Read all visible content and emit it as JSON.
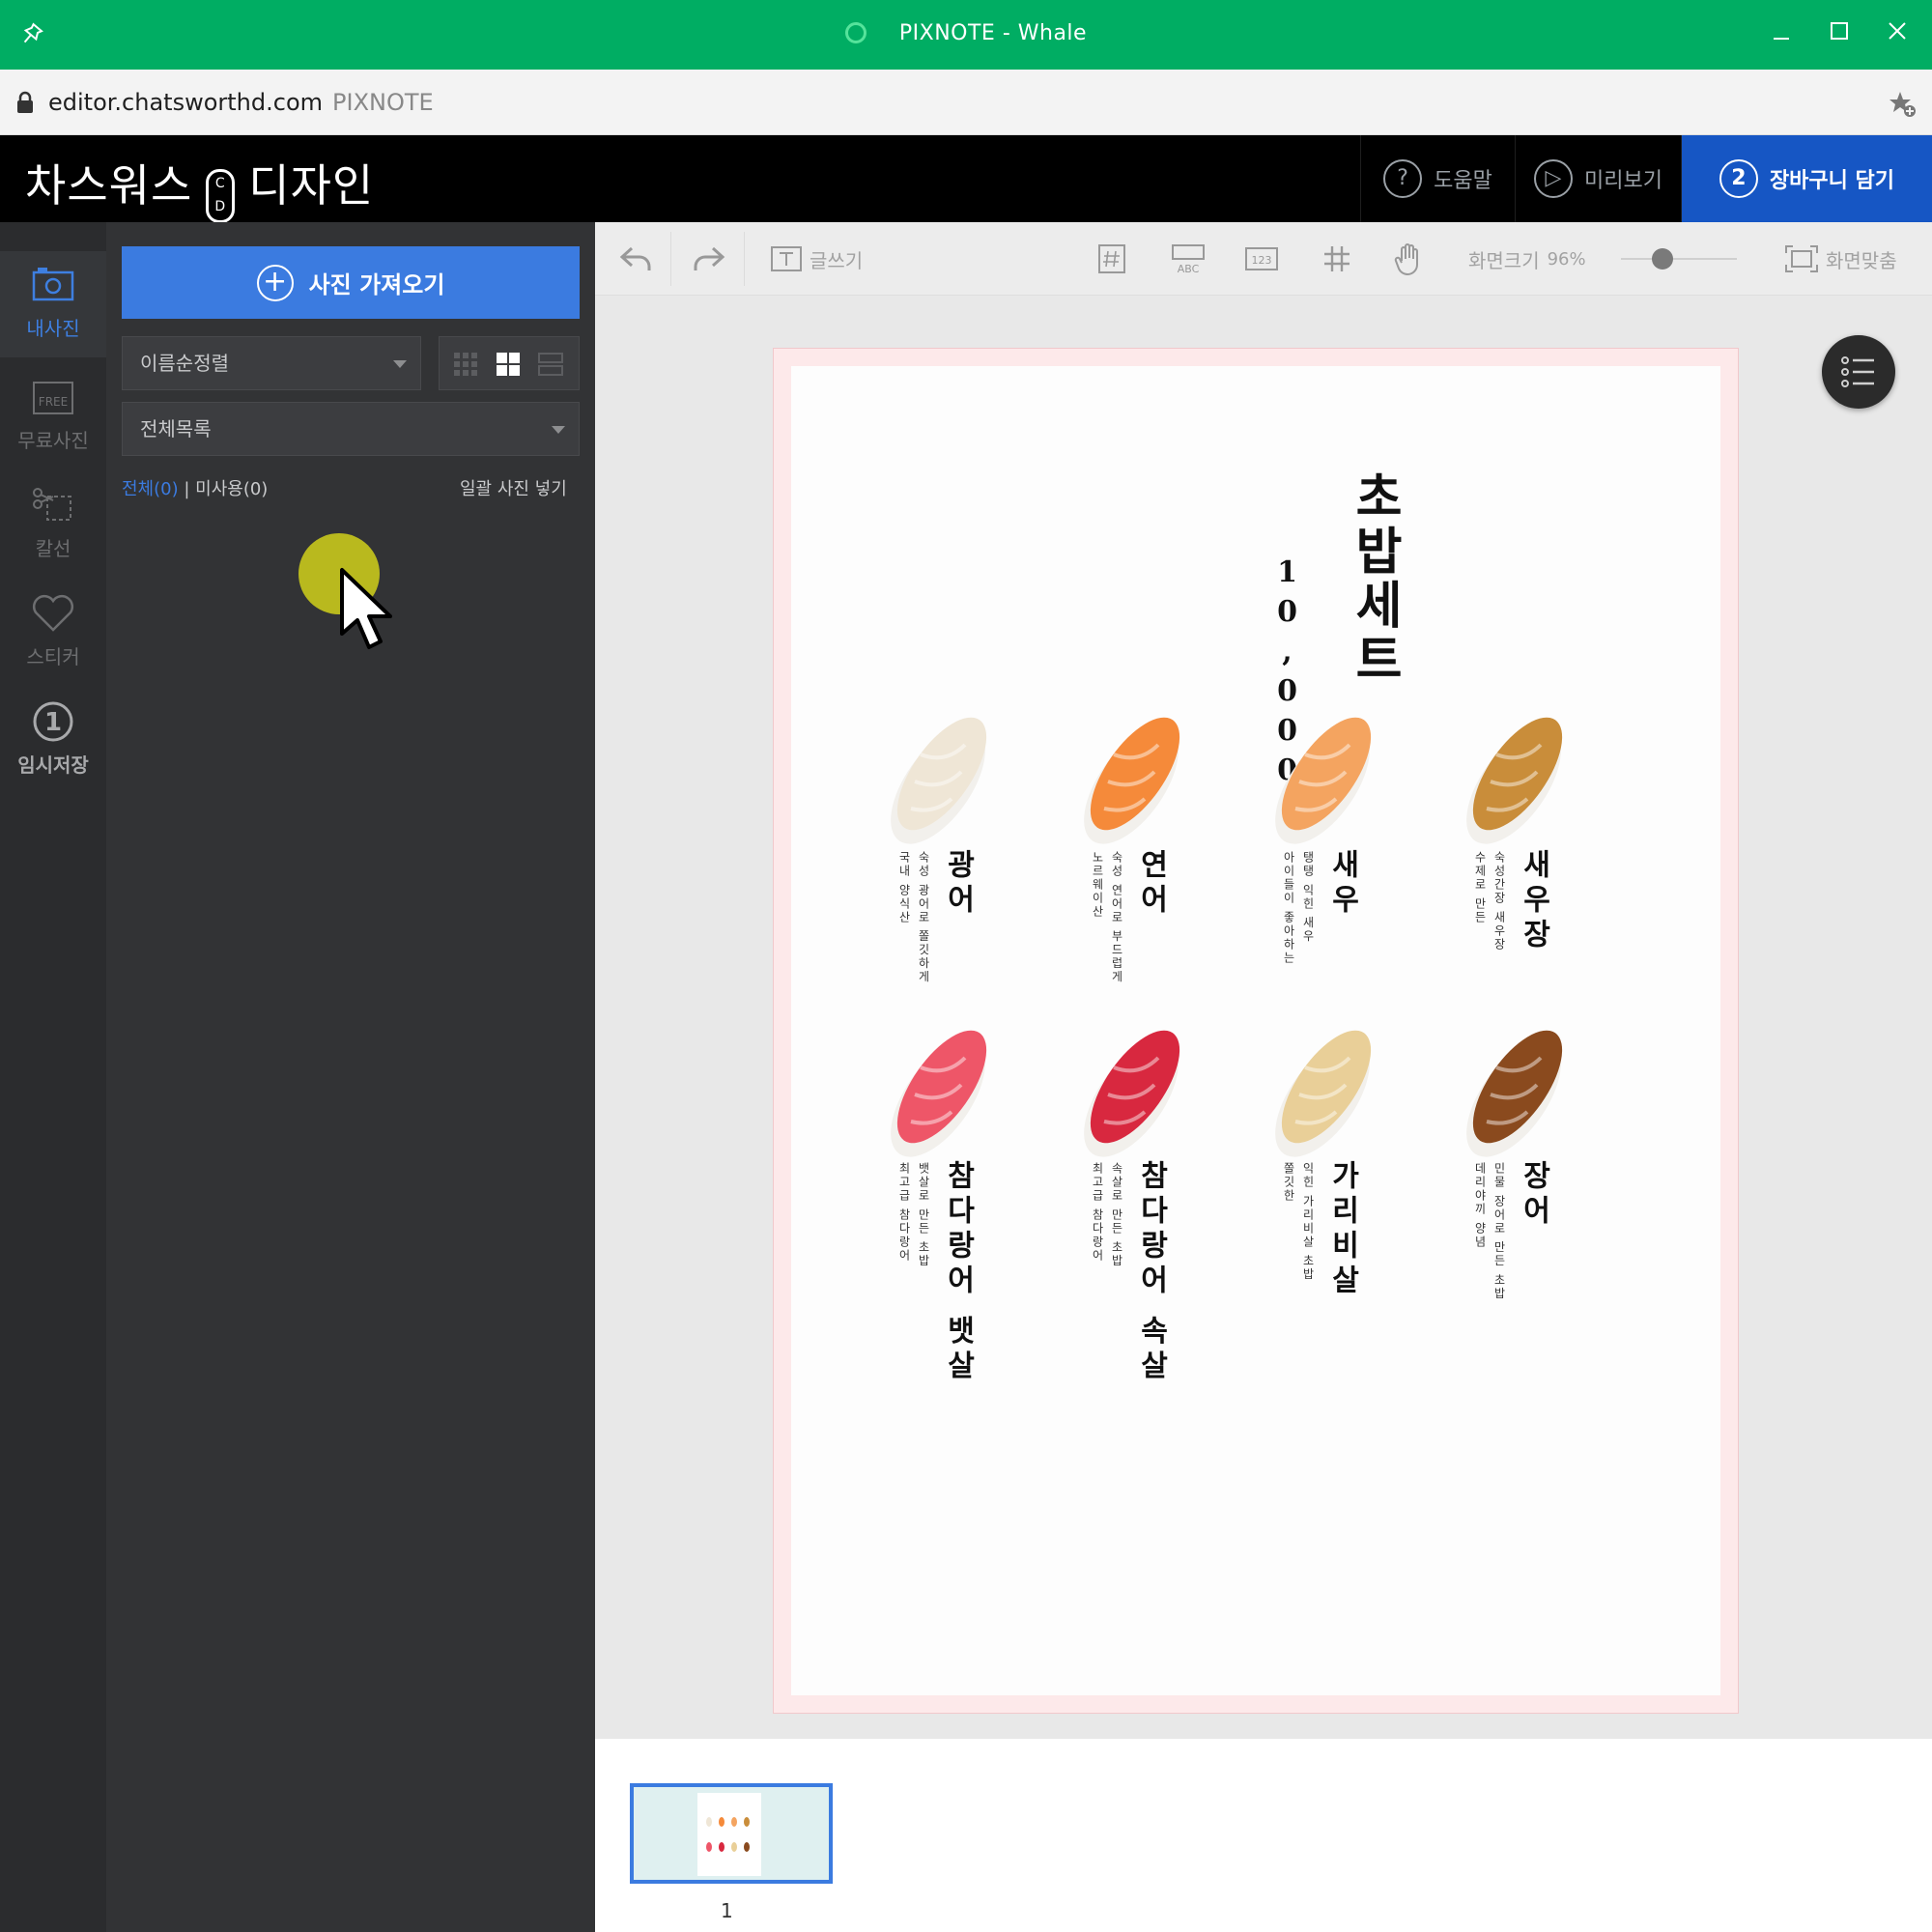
{
  "window": {
    "title": "PIXNOTE - Whale"
  },
  "address": {
    "url": "editor.chatsworthd.com",
    "site_name": "PIXNOTE"
  },
  "header": {
    "brand_left": "차스워스",
    "brand_logo": "C D",
    "brand_right": "디자인",
    "help_label": "도움말",
    "preview_label": "미리보기",
    "cart_step": "2",
    "cart_label": "장바구니 담기"
  },
  "rail": {
    "items": [
      {
        "label": "내사진",
        "icon": "camera-icon",
        "active": true
      },
      {
        "label": "무료사진",
        "icon": "free-photo-icon"
      },
      {
        "label": "칼선",
        "icon": "scissors-icon"
      },
      {
        "label": "스티커",
        "icon": "heart-icon"
      },
      {
        "label": "임시저장",
        "icon": "step-one-icon",
        "step": "1"
      }
    ]
  },
  "panel": {
    "import_label": "사진 가져오기",
    "sort_value": "이름순정렬",
    "folder_value": "전체목록",
    "count_all": "전체(0)",
    "count_unused": "미사용(0)",
    "bulk_insert": "일괄 사진 넣기"
  },
  "toolbar": {
    "text_tool": "글쓰기",
    "zoom_label": "화면크기",
    "zoom_value": "96%",
    "zoom_level": 0.5,
    "fit_label": "화면맞춤",
    "abc": "ABC",
    "num": "123"
  },
  "menu": {
    "title": "초밥세트",
    "price": "10,000",
    "items": [
      {
        "name": "광어",
        "desc1": "숙성 광어로 쫄깃하게",
        "desc2": "국내 양식산",
        "color": "#efe6d6"
      },
      {
        "name": "연어",
        "desc1": "숙성 연어로 부드럽게",
        "desc2": "노르웨이산",
        "color": "#f58a3a"
      },
      {
        "name": "새우",
        "desc1": "탱탱 익힌 새우",
        "desc2": "아이들이 좋아하는",
        "color": "#f4a460"
      },
      {
        "name": "새우장",
        "desc1": "숙성간장 새우장",
        "desc2": "수제로 만든",
        "color": "#c98d3a"
      },
      {
        "name": "참다랑어 뱃살",
        "desc1": "뱃살로 만든 초밥",
        "desc2": "최고급 참다랑어",
        "color": "#ee5668"
      },
      {
        "name": "참다랑어 속살",
        "desc1": "속살로 만든 초밥",
        "desc2": "최고급 참다랑어",
        "color": "#d8283f"
      },
      {
        "name": "가리비살",
        "desc1": "익힌 가리비살 초밥",
        "desc2": "쫄깃한",
        "color": "#e9cf98"
      },
      {
        "name": "장어",
        "desc1": "민물 장어로 만든 초밥",
        "desc2": "데리야끼 양념",
        "color": "#8a4a1e"
      }
    ]
  },
  "strip": {
    "page_number": "1"
  }
}
